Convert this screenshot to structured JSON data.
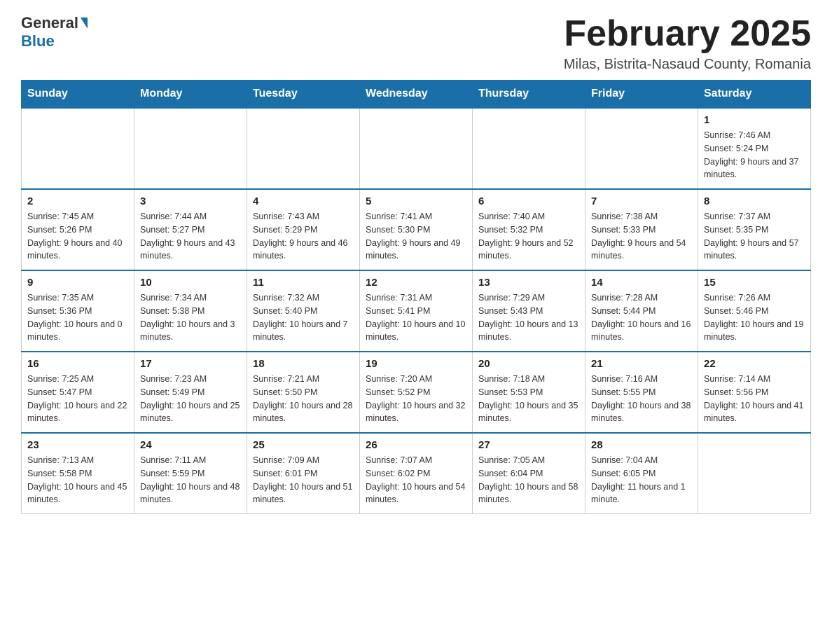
{
  "header": {
    "logo_general": "General",
    "logo_blue": "Blue",
    "month_title": "February 2025",
    "subtitle": "Milas, Bistrita-Nasaud County, Romania"
  },
  "weekdays": [
    "Sunday",
    "Monday",
    "Tuesday",
    "Wednesday",
    "Thursday",
    "Friday",
    "Saturday"
  ],
  "weeks": [
    [
      {
        "day": "",
        "info": ""
      },
      {
        "day": "",
        "info": ""
      },
      {
        "day": "",
        "info": ""
      },
      {
        "day": "",
        "info": ""
      },
      {
        "day": "",
        "info": ""
      },
      {
        "day": "",
        "info": ""
      },
      {
        "day": "1",
        "info": "Sunrise: 7:46 AM\nSunset: 5:24 PM\nDaylight: 9 hours and 37 minutes."
      }
    ],
    [
      {
        "day": "2",
        "info": "Sunrise: 7:45 AM\nSunset: 5:26 PM\nDaylight: 9 hours and 40 minutes."
      },
      {
        "day": "3",
        "info": "Sunrise: 7:44 AM\nSunset: 5:27 PM\nDaylight: 9 hours and 43 minutes."
      },
      {
        "day": "4",
        "info": "Sunrise: 7:43 AM\nSunset: 5:29 PM\nDaylight: 9 hours and 46 minutes."
      },
      {
        "day": "5",
        "info": "Sunrise: 7:41 AM\nSunset: 5:30 PM\nDaylight: 9 hours and 49 minutes."
      },
      {
        "day": "6",
        "info": "Sunrise: 7:40 AM\nSunset: 5:32 PM\nDaylight: 9 hours and 52 minutes."
      },
      {
        "day": "7",
        "info": "Sunrise: 7:38 AM\nSunset: 5:33 PM\nDaylight: 9 hours and 54 minutes."
      },
      {
        "day": "8",
        "info": "Sunrise: 7:37 AM\nSunset: 5:35 PM\nDaylight: 9 hours and 57 minutes."
      }
    ],
    [
      {
        "day": "9",
        "info": "Sunrise: 7:35 AM\nSunset: 5:36 PM\nDaylight: 10 hours and 0 minutes."
      },
      {
        "day": "10",
        "info": "Sunrise: 7:34 AM\nSunset: 5:38 PM\nDaylight: 10 hours and 3 minutes."
      },
      {
        "day": "11",
        "info": "Sunrise: 7:32 AM\nSunset: 5:40 PM\nDaylight: 10 hours and 7 minutes."
      },
      {
        "day": "12",
        "info": "Sunrise: 7:31 AM\nSunset: 5:41 PM\nDaylight: 10 hours and 10 minutes."
      },
      {
        "day": "13",
        "info": "Sunrise: 7:29 AM\nSunset: 5:43 PM\nDaylight: 10 hours and 13 minutes."
      },
      {
        "day": "14",
        "info": "Sunrise: 7:28 AM\nSunset: 5:44 PM\nDaylight: 10 hours and 16 minutes."
      },
      {
        "day": "15",
        "info": "Sunrise: 7:26 AM\nSunset: 5:46 PM\nDaylight: 10 hours and 19 minutes."
      }
    ],
    [
      {
        "day": "16",
        "info": "Sunrise: 7:25 AM\nSunset: 5:47 PM\nDaylight: 10 hours and 22 minutes."
      },
      {
        "day": "17",
        "info": "Sunrise: 7:23 AM\nSunset: 5:49 PM\nDaylight: 10 hours and 25 minutes."
      },
      {
        "day": "18",
        "info": "Sunrise: 7:21 AM\nSunset: 5:50 PM\nDaylight: 10 hours and 28 minutes."
      },
      {
        "day": "19",
        "info": "Sunrise: 7:20 AM\nSunset: 5:52 PM\nDaylight: 10 hours and 32 minutes."
      },
      {
        "day": "20",
        "info": "Sunrise: 7:18 AM\nSunset: 5:53 PM\nDaylight: 10 hours and 35 minutes."
      },
      {
        "day": "21",
        "info": "Sunrise: 7:16 AM\nSunset: 5:55 PM\nDaylight: 10 hours and 38 minutes."
      },
      {
        "day": "22",
        "info": "Sunrise: 7:14 AM\nSunset: 5:56 PM\nDaylight: 10 hours and 41 minutes."
      }
    ],
    [
      {
        "day": "23",
        "info": "Sunrise: 7:13 AM\nSunset: 5:58 PM\nDaylight: 10 hours and 45 minutes."
      },
      {
        "day": "24",
        "info": "Sunrise: 7:11 AM\nSunset: 5:59 PM\nDaylight: 10 hours and 48 minutes."
      },
      {
        "day": "25",
        "info": "Sunrise: 7:09 AM\nSunset: 6:01 PM\nDaylight: 10 hours and 51 minutes."
      },
      {
        "day": "26",
        "info": "Sunrise: 7:07 AM\nSunset: 6:02 PM\nDaylight: 10 hours and 54 minutes."
      },
      {
        "day": "27",
        "info": "Sunrise: 7:05 AM\nSunset: 6:04 PM\nDaylight: 10 hours and 58 minutes."
      },
      {
        "day": "28",
        "info": "Sunrise: 7:04 AM\nSunset: 6:05 PM\nDaylight: 11 hours and 1 minute."
      },
      {
        "day": "",
        "info": ""
      }
    ]
  ]
}
